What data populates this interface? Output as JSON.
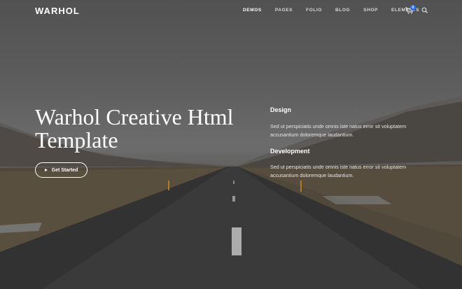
{
  "brand": {
    "logo": "WARHOL"
  },
  "nav": {
    "items": [
      {
        "label": "DEMOS"
      },
      {
        "label": "PAGES"
      },
      {
        "label": "FOLIO"
      },
      {
        "label": "BLOG"
      },
      {
        "label": "SHOP"
      },
      {
        "label": "ELEMENTS"
      }
    ],
    "cart_count": "0",
    "icons": [
      "cart-icon",
      "search-icon"
    ]
  },
  "hero": {
    "title": "Warhol Creative Html Template",
    "button_label": "Get Started"
  },
  "features": [
    {
      "heading": "Design",
      "text": "Sed ut perspiciatis unde omnis iste natus error sit voluptatem accusantium doloremque laudantium."
    },
    {
      "heading": "Development",
      "text": "Sed ut perspiciatis unde omnis iste natus error sit voluptatem accusantium doloremque laudantium."
    }
  ],
  "colors": {
    "accent": "#2d6ff0",
    "text": "#ffffff"
  }
}
